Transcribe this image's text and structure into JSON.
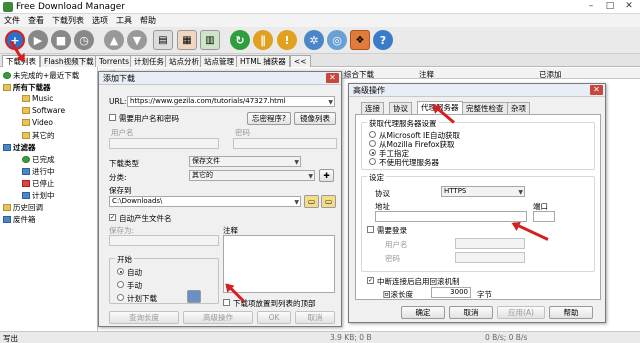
{
  "app": {
    "title": "Free Download Manager"
  },
  "menu": [
    "文件",
    "查看",
    "下载列表",
    "选项",
    "工具",
    "帮助"
  ],
  "tabs": [
    "下载列表",
    "Flash视频下载",
    "Torrents",
    "计划任务",
    "站点分析",
    "站点管理",
    "HTML 捕获器",
    "<<"
  ],
  "tree": {
    "items": [
      "未完成的+最近下载",
      "所有下载器",
      "Music",
      "Software",
      "Video",
      "其它的",
      "过滤器",
      "已完成",
      "进行中",
      "已停止",
      "计划中",
      "历史回调",
      "废件箱"
    ]
  },
  "list_header": {
    "col1": "下载",
    "col2": "综合下载",
    "col3": "注释",
    "col4": "已添加"
  },
  "status": {
    "text": "写出",
    "speed": "3.9 KB; 0 B",
    "rate": "0 B/s; 0 B/s"
  },
  "add_dialog": {
    "title": "添加下载",
    "url_label": "URL:",
    "url_value": "https://www.gezila.com/tutorials/47327.html",
    "need_login": "需要用户名和密码",
    "user_label": "用户名",
    "pass_label": "密码",
    "prog_btn": "忘密程序?",
    "mirror_btn": "镜像列表",
    "type_label": "下载类型",
    "type_value": "保存文件",
    "category_label": "分类:",
    "category_value": "其它的",
    "save_to_label": "保存到",
    "save_path": "C:\\Downloads\\",
    "auto_name": "自动产生文件名",
    "save_as_label": "保存为:",
    "comment_label": "注释",
    "start_group": "开始",
    "start_auto": "自动",
    "start_manual": "手动",
    "start_schedule": "计划下载",
    "place_top": "下载项放置到列表的顶部",
    "query_btn": "查询长度",
    "advanced_btn": "高级操作",
    "ok_btn": "OK",
    "cancel_btn": "取消"
  },
  "adv_dialog": {
    "title": "高级操作",
    "tabs": [
      "连接",
      "协议",
      "代理服务器",
      "完整性检查",
      "杂项"
    ],
    "proxy_group": "获取代理服务器设置",
    "opt_ie": "从Microsoft IE自动获取",
    "opt_firefox": "从Mozilla Firefox获取",
    "opt_manual": "手工指定",
    "opt_none": "不使用代理服务器",
    "settings_group": "设定",
    "protocol_label": "协议",
    "protocol_value": "HTTPS",
    "address_label": "地址",
    "port_label": "端口",
    "need_login": "需要登录",
    "user_label": "用户名",
    "pass_label": "密码",
    "reconnect": "中断连接后启用回滚机制",
    "rollback_label": "回滚长度",
    "rollback_value": "3000",
    "rollback_unit": "字节",
    "ok_btn": "确定",
    "cancel_btn": "取消",
    "apply_btn": "应用(A)",
    "help_btn": "帮助"
  }
}
